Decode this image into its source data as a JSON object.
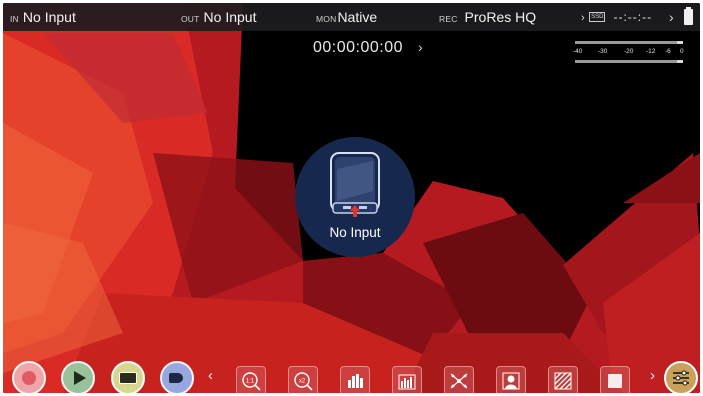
{
  "status_bar": {
    "in_label": "IN",
    "in_value": "No Input",
    "out_label": "OUT",
    "out_value": "No Input",
    "mon_label": "MON",
    "mon_value": "Native",
    "rec_label": "REC",
    "rec_value": "ProRes HQ",
    "media_label": "SSD",
    "media_time": "--:--:--"
  },
  "timecode": "00:00:00:00",
  "audio_meter": {
    "scale": [
      "-40",
      "-30",
      "-20",
      "-12",
      "-6",
      "0"
    ]
  },
  "center": {
    "message": "No Input",
    "icon": "monitor-device-icon"
  },
  "transport": [
    {
      "name": "record",
      "icon": "record-icon",
      "color": "#f0a6a8"
    },
    {
      "name": "play",
      "icon": "play-icon",
      "color": "#99c29a"
    },
    {
      "name": "playlist",
      "icon": "clip-icon",
      "color": "#d8d68c"
    },
    {
      "name": "tag",
      "icon": "tag-icon",
      "color": "#96a8dd"
    }
  ],
  "tools": [
    {
      "name": "zoom-1-1",
      "icon": "zoom-1to1-icon",
      "text": "1:1"
    },
    {
      "name": "zoom-2x",
      "icon": "zoom-2x-icon",
      "text": "x2"
    },
    {
      "name": "waveform",
      "icon": "waveform-icon"
    },
    {
      "name": "vectorscope-rgb",
      "icon": "rgb-parade-icon"
    },
    {
      "name": "vectorscope",
      "icon": "vectorscope-icon"
    },
    {
      "name": "false-color",
      "icon": "person-icon"
    },
    {
      "name": "zebra",
      "icon": "zebra-icon"
    },
    {
      "name": "frame-guide",
      "icon": "frame-guide-icon"
    }
  ],
  "colors": {
    "top_bar": "#1c1c1e",
    "badge": "#17284f",
    "accent_red": "#d8262a"
  }
}
